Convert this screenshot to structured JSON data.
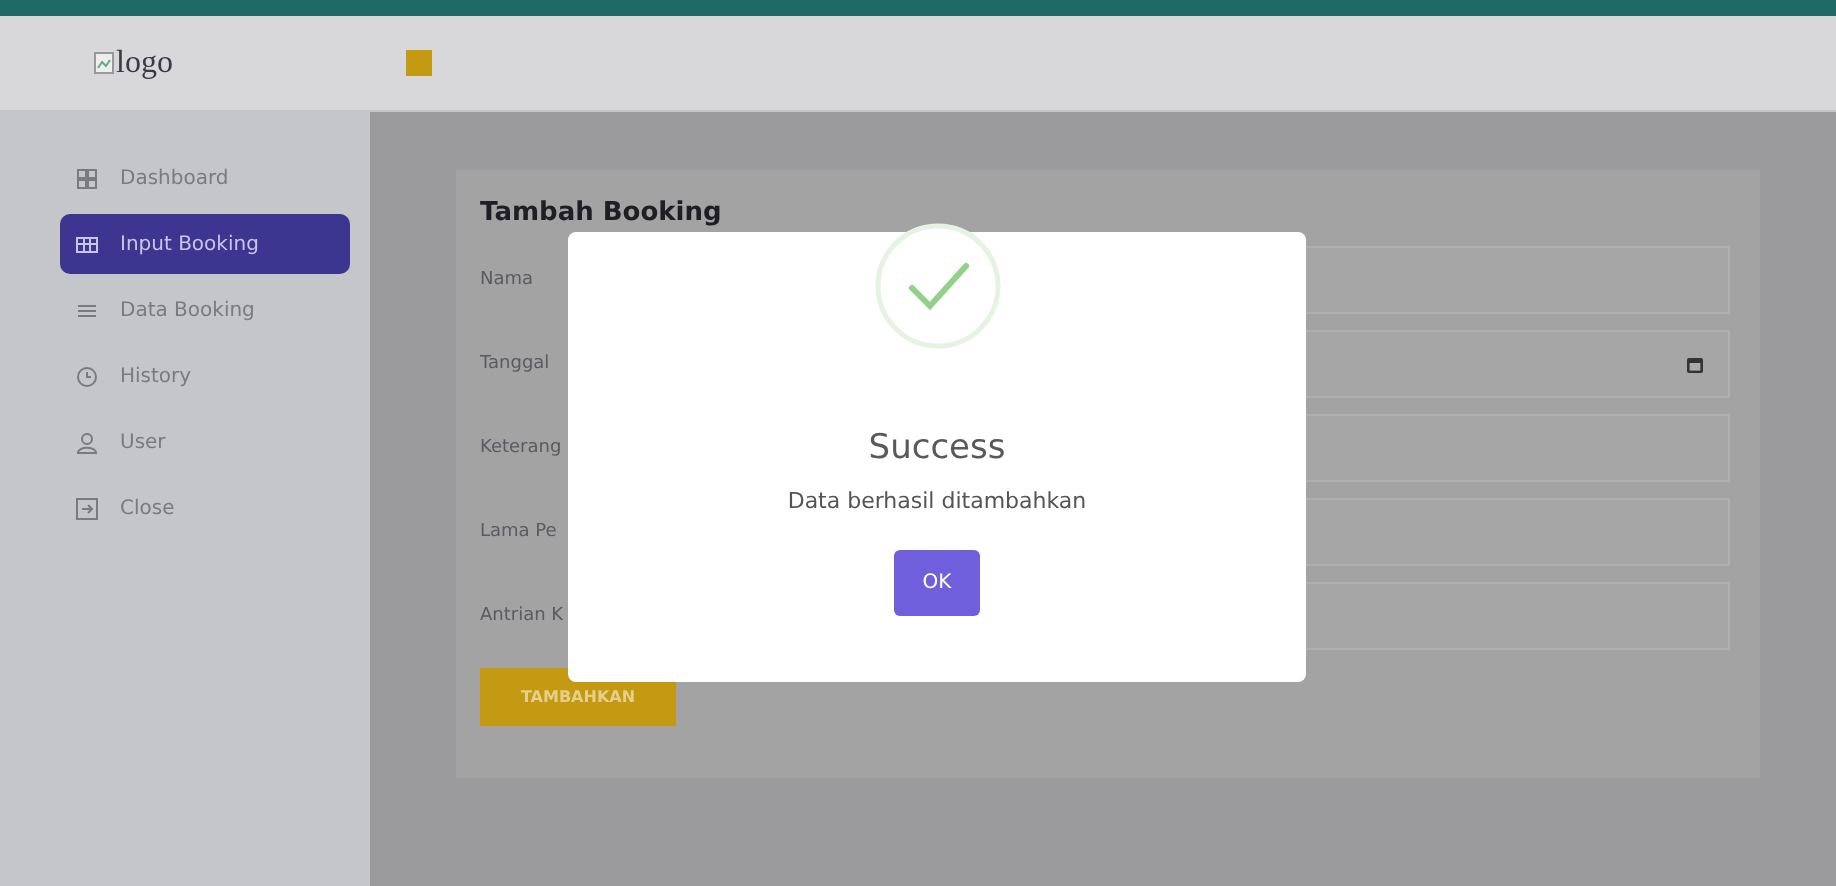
{
  "header": {
    "logo_alt": "logo"
  },
  "sidebar": {
    "items": [
      {
        "label": "Dashboard",
        "kind": "grid",
        "selected": false
      },
      {
        "label": "Input Booking",
        "kind": "table",
        "selected": true
      },
      {
        "label": "Data Booking",
        "kind": "list",
        "selected": false
      },
      {
        "label": "History",
        "kind": "clock",
        "selected": false
      },
      {
        "label": "User",
        "kind": "user",
        "selected": false
      },
      {
        "label": "Close",
        "kind": "exit",
        "selected": false
      }
    ]
  },
  "form": {
    "title": "Tambah Booking",
    "fields": [
      {
        "label": "Nama",
        "kind": "text"
      },
      {
        "label": "Tanggal",
        "kind": "date"
      },
      {
        "label": "Keterang",
        "kind": "text"
      },
      {
        "label": "Lama Pe",
        "kind": "text"
      },
      {
        "label": "Antrian K",
        "kind": "text"
      }
    ],
    "submit": "TAMBAHKAN"
  },
  "dialog": {
    "kind": "success",
    "title": "Success",
    "message": "Data berhasil ditambahkan",
    "button": "OK"
  }
}
